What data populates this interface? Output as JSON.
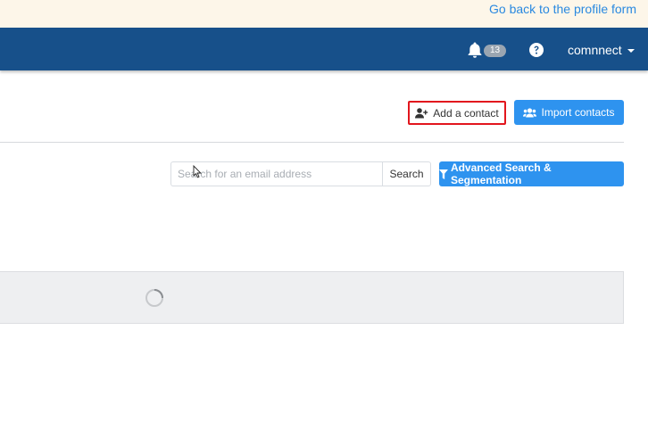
{
  "topbar": {
    "back_link": "Go back to the profile form"
  },
  "navbar": {
    "notifications_count": "13",
    "username": "comnnect"
  },
  "toolbar": {
    "add_contact_label": "Add a contact",
    "import_contacts_label": "Import contacts"
  },
  "search": {
    "placeholder": "Search for an email address",
    "button_label": "Search",
    "advanced_label": "Advanced Search & Segmentation"
  },
  "colors": {
    "navbar": "#17508a",
    "primary_button": "#2e93ef",
    "highlight_border": "#e2161d",
    "link": "#2a89e0"
  },
  "icons": [
    "bell-icon",
    "question-circle-icon",
    "user-plus-icon",
    "users-icon",
    "filter-icon",
    "spinner-icon",
    "mouse-cursor-icon"
  ]
}
